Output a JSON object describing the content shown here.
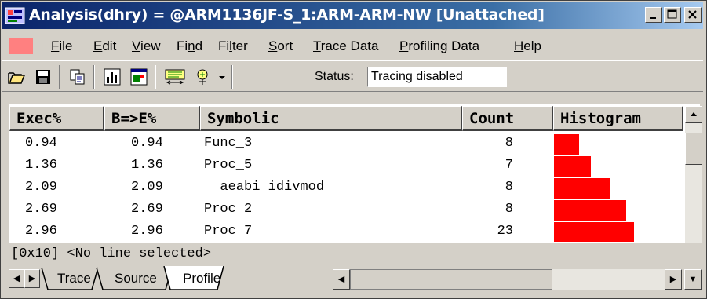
{
  "window": {
    "title": "Analysis(dhry) = @ARM1136JF-S_1:ARM-ARM-NW [Unattached]",
    "accent_color": "#0a246a"
  },
  "menu": {
    "items": [
      {
        "label": "File",
        "underline": "F"
      },
      {
        "label": "Edit",
        "underline": "E"
      },
      {
        "label": "View",
        "underline": "V"
      },
      {
        "label": "Find",
        "underline": "n"
      },
      {
        "label": "Filter",
        "underline": "l"
      },
      {
        "label": "Sort",
        "underline": "S"
      },
      {
        "label": "Trace Data",
        "underline": "T"
      },
      {
        "label": "Profiling Data",
        "underline": "P"
      },
      {
        "label": "Help",
        "underline": "H"
      }
    ]
  },
  "toolbar": {
    "icons": [
      "open-folder-icon",
      "save-icon",
      "copy-icon",
      "chart-icon",
      "window-icon",
      "trace-filter-icon",
      "trace-options-icon",
      "dropdown-arrow-icon"
    ],
    "status_label": "Status:",
    "status_value": "Tracing disabled"
  },
  "table": {
    "columns": [
      "Exec%",
      "B=>E%",
      "Symbolic",
      "Count",
      "Histogram"
    ],
    "rows": [
      {
        "exec": "0.94",
        "be": "0.94",
        "symbol": "Func_3",
        "count": "8",
        "hist": 0.94
      },
      {
        "exec": "1.36",
        "be": "1.36",
        "symbol": "Proc_5",
        "count": "7",
        "hist": 1.36
      },
      {
        "exec": "2.09",
        "be": "2.09",
        "symbol": "__aeabi_idivmod",
        "count": "8",
        "hist": 2.09
      },
      {
        "exec": "2.69",
        "be": "2.69",
        "symbol": "Proc_2",
        "count": "8",
        "hist": 2.69
      },
      {
        "exec": "2.96",
        "be": "2.96",
        "symbol": "Proc_7",
        "count": "23",
        "hist": 2.96
      }
    ],
    "bar_color": "#ff0000"
  },
  "status_line": "[0x10] <No line selected>",
  "tabs": {
    "items": [
      "Trace",
      "Source",
      "Profile"
    ],
    "active": "Profile"
  }
}
